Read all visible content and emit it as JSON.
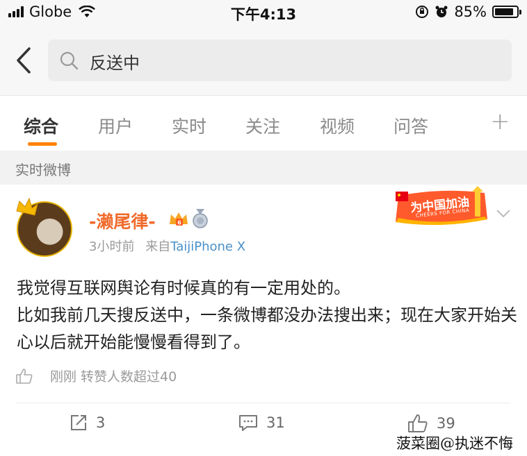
{
  "status_bar": {
    "carrier": "Globe",
    "time": "下午4:13",
    "battery": "85%",
    "battery_level": 0.85
  },
  "header": {
    "search": {
      "query": "反送中"
    }
  },
  "tabs": [
    {
      "label": "综合",
      "active": true
    },
    {
      "label": "用户",
      "active": false
    },
    {
      "label": "实时",
      "active": false
    },
    {
      "label": "关注",
      "active": false
    },
    {
      "label": "视频",
      "active": false
    },
    {
      "label": "问答",
      "active": false
    }
  ],
  "add_tab_symbol": "+",
  "section": {
    "title": "实时微博"
  },
  "post": {
    "username": "-濑尾律-",
    "time": "3小时前",
    "source_prefix": "来自",
    "source": "TaijiPhone X",
    "badge_level": "6",
    "promo_label": "为中国加油",
    "promo_sub": "CHEERS FOR CHINA",
    "text": "我觉得互联网舆论有时候真的有一定用处的。\n比如我前几天搜反送中，一条微博都没办法搜出来；现在大家开始关心以后就开始能慢慢看得到了。",
    "likes_line": "刚刚 转赞人数超过40",
    "actions": {
      "reposts": "3",
      "comments": "31",
      "likes": "39"
    }
  },
  "watermark": "菠菜圈@执迷不悔",
  "colors": {
    "accent": "#ff8200",
    "username": "#f06a2a",
    "link": "#4a90c8"
  }
}
